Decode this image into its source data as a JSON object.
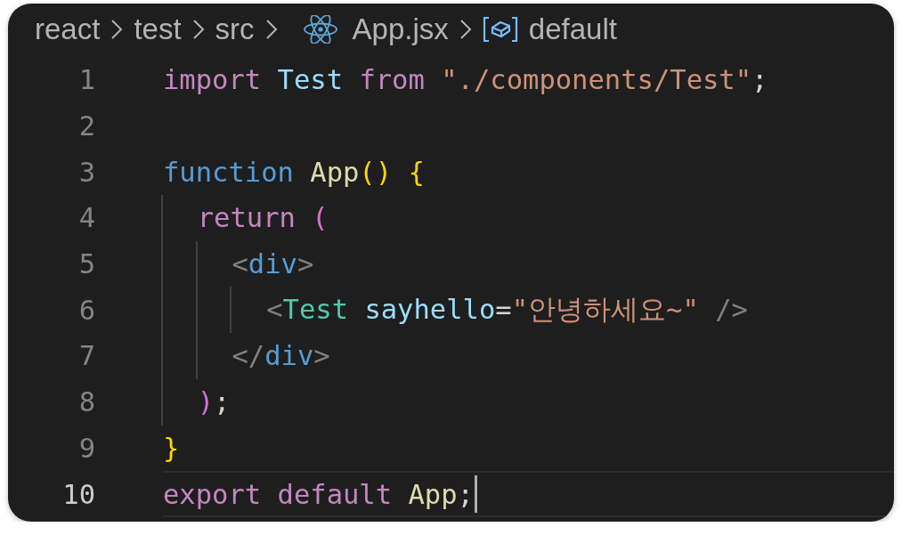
{
  "breadcrumb": [
    {
      "kind": "folder",
      "label": "react"
    },
    {
      "kind": "folder",
      "label": "test"
    },
    {
      "kind": "folder",
      "label": "src"
    },
    {
      "kind": "react-file",
      "label": "App.jsx"
    },
    {
      "kind": "symbol",
      "label": "default"
    }
  ],
  "lines": [
    {
      "number": "1",
      "current": false,
      "tokens": [
        {
          "kind": "keyword",
          "text": "import"
        },
        {
          "kind": "variable",
          "text": " Test"
        },
        {
          "kind": "keyword",
          "text": " from"
        },
        {
          "kind": "string",
          "text": " \"./components/Test\""
        },
        {
          "kind": "plain",
          "text": ";"
        }
      ]
    },
    {
      "number": "2",
      "current": false
    },
    {
      "number": "3",
      "current": false,
      "tokens": [
        {
          "kind": "storage",
          "text": "function"
        },
        {
          "kind": "function",
          "text": " App"
        },
        {
          "kind": "bracket1",
          "text": "()"
        },
        {
          "kind": "bracket1",
          "text": " {"
        }
      ]
    },
    {
      "number": "4",
      "current": false,
      "indent_guides": [
        {
          "kind": "guide"
        }
      ],
      "tokens": [
        {
          "kind": "keyword",
          "text": "return"
        },
        {
          "kind": "bracket2",
          "text": " ("
        }
      ]
    },
    {
      "number": "5",
      "current": false,
      "indent_guides": [
        {
          "kind": "guide"
        },
        {
          "kind": "guide"
        }
      ],
      "tokens": [
        {
          "kind": "punct",
          "text": "<"
        },
        {
          "kind": "tag",
          "text": "div"
        },
        {
          "kind": "punct",
          "text": ">"
        }
      ]
    },
    {
      "number": "6",
      "current": false,
      "indent_guides": [
        {
          "kind": "guide"
        },
        {
          "kind": "guide"
        },
        {
          "kind": "guide"
        }
      ],
      "tokens": [
        {
          "kind": "punct",
          "text": "<"
        },
        {
          "kind": "component",
          "text": "Test"
        },
        {
          "kind": "attribute",
          "text": " sayhello"
        },
        {
          "kind": "plain",
          "text": "="
        },
        {
          "kind": "string",
          "text": "\"안녕하세요~\""
        },
        {
          "kind": "punct",
          "text": " />"
        }
      ]
    },
    {
      "number": "7",
      "current": false,
      "indent_guides": [
        {
          "kind": "guide"
        },
        {
          "kind": "guide"
        }
      ],
      "tokens": [
        {
          "kind": "punct",
          "text": "</"
        },
        {
          "kind": "tag",
          "text": "div"
        },
        {
          "kind": "punct",
          "text": ">"
        }
      ]
    },
    {
      "number": "8",
      "current": false,
      "indent_guides": [
        {
          "kind": "guide"
        }
      ],
      "tokens": [
        {
          "kind": "bracket2",
          "text": ")"
        },
        {
          "kind": "plain",
          "text": ";"
        }
      ]
    },
    {
      "number": "9",
      "current": false,
      "tokens": [
        {
          "kind": "bracket1",
          "text": "}"
        }
      ]
    },
    {
      "number": "10",
      "current": true,
      "tokens": [
        {
          "kind": "keyword",
          "text": "export"
        },
        {
          "kind": "keyword",
          "text": " default"
        },
        {
          "kind": "function",
          "text": " App"
        },
        {
          "kind": "plain",
          "text": ";"
        }
      ]
    }
  ]
}
